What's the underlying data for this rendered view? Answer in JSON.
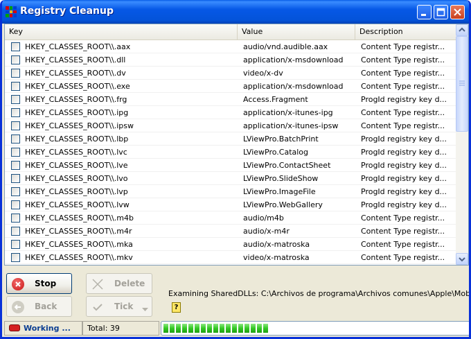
{
  "window": {
    "title": "Registry Cleanup"
  },
  "table": {
    "columns": [
      "Key",
      "Value",
      "Description"
    ],
    "rows": [
      {
        "key": "HKEY_CLASSES_ROOT\\\\.aax",
        "value": "audio/vnd.audible.aax",
        "desc": "Content Type registr..."
      },
      {
        "key": "HKEY_CLASSES_ROOT\\\\.dll",
        "value": "application/x-msdownload",
        "desc": "Content Type registr..."
      },
      {
        "key": "HKEY_CLASSES_ROOT\\\\.dv",
        "value": "video/x-dv",
        "desc": "Content Type registr..."
      },
      {
        "key": "HKEY_CLASSES_ROOT\\\\.exe",
        "value": "application/x-msdownload",
        "desc": "Content Type registr..."
      },
      {
        "key": "HKEY_CLASSES_ROOT\\\\.frg",
        "value": "Access.Fragment",
        "desc": "ProgId registry key d..."
      },
      {
        "key": "HKEY_CLASSES_ROOT\\\\.ipg",
        "value": "application/x-itunes-ipg",
        "desc": "Content Type registr..."
      },
      {
        "key": "HKEY_CLASSES_ROOT\\\\.ipsw",
        "value": "application/x-itunes-ipsw",
        "desc": "Content Type registr..."
      },
      {
        "key": "HKEY_CLASSES_ROOT\\\\.lbp",
        "value": "LViewPro.BatchPrint",
        "desc": "ProgId registry key d..."
      },
      {
        "key": "HKEY_CLASSES_ROOT\\\\.lvc",
        "value": "LViewPro.Catalog",
        "desc": "ProgId registry key d..."
      },
      {
        "key": "HKEY_CLASSES_ROOT\\\\.lve",
        "value": "LViewPro.ContactSheet",
        "desc": "ProgId registry key d..."
      },
      {
        "key": "HKEY_CLASSES_ROOT\\\\.lvo",
        "value": "LViewPro.SlideShow",
        "desc": "ProgId registry key d..."
      },
      {
        "key": "HKEY_CLASSES_ROOT\\\\.lvp",
        "value": "LViewPro.ImageFile",
        "desc": "ProgId registry key d..."
      },
      {
        "key": "HKEY_CLASSES_ROOT\\\\.lvw",
        "value": "LViewPro.WebGallery",
        "desc": "ProgId registry key d..."
      },
      {
        "key": "HKEY_CLASSES_ROOT\\\\.m4b",
        "value": "audio/m4b",
        "desc": "Content Type registr..."
      },
      {
        "key": "HKEY_CLASSES_ROOT\\\\.m4r",
        "value": "audio/x-m4r",
        "desc": "Content Type registr..."
      },
      {
        "key": "HKEY_CLASSES_ROOT\\\\.mka",
        "value": "audio/x-matroska",
        "desc": "Content Type registr..."
      },
      {
        "key": "HKEY_CLASSES_ROOT\\\\.mkv",
        "value": "video/x-matroska",
        "desc": "Content Type registr..."
      }
    ]
  },
  "buttons": {
    "stop": "Stop",
    "delete": "Delete",
    "back": "Back",
    "tick": "Tick"
  },
  "status": {
    "message": "Examining SharedDLLs: C:\\Archivos de programa\\Archivos comunes\\Apple\\Mobile",
    "help": "?",
    "working": "Working ...",
    "total": "Total: 39",
    "progress_fraction": 0.36
  },
  "icons": [
    "app-icon",
    "minimize-icon",
    "maximize-icon",
    "close-icon",
    "stop-icon",
    "delete-icon",
    "back-icon",
    "tick-icon",
    "chevron-down-icon",
    "help-icon",
    "scroll-up-icon",
    "scroll-down-icon"
  ],
  "colors": {
    "titlebar": "#0453d9",
    "progress": "#34c924",
    "stop": "#d42020"
  }
}
